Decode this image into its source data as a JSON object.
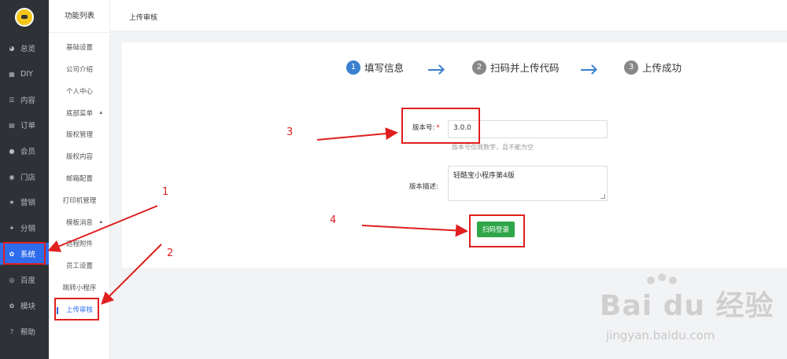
{
  "sidebar": {
    "items": [
      {
        "label": "总览",
        "icon": "chart-pie-icon",
        "glyph": "◕"
      },
      {
        "label": "DIY",
        "icon": "layout-icon",
        "glyph": "▦"
      },
      {
        "label": "内容",
        "icon": "list-icon",
        "glyph": "☰"
      },
      {
        "label": "订单",
        "icon": "order-icon",
        "glyph": "▤"
      },
      {
        "label": "会员",
        "icon": "user-icon",
        "glyph": "●"
      },
      {
        "label": "门店",
        "icon": "location-icon",
        "glyph": "◉"
      },
      {
        "label": "营销",
        "icon": "star-icon",
        "glyph": "★"
      },
      {
        "label": "分销",
        "icon": "users-icon",
        "glyph": "✦"
      },
      {
        "label": "系统",
        "icon": "gear-icon",
        "glyph": "✿"
      },
      {
        "label": "百度",
        "icon": "baidu-icon",
        "glyph": "◎"
      },
      {
        "label": "模块",
        "icon": "module-icon",
        "glyph": "✿"
      },
      {
        "label": "帮助",
        "icon": "help-icon",
        "glyph": "?"
      }
    ],
    "active_index": 8
  },
  "submenu": {
    "title": "功能列表",
    "items": [
      {
        "label": "基础设置"
      },
      {
        "label": "公司介绍"
      },
      {
        "label": "个人中心"
      },
      {
        "label": "底部菜单",
        "caret": "▴"
      },
      {
        "label": "版权管理"
      },
      {
        "label": "版权内容"
      },
      {
        "label": "邮箱配置"
      },
      {
        "label": "打印机管理"
      },
      {
        "label": "模板消息",
        "caret": "▴"
      },
      {
        "label": "远程附件"
      },
      {
        "label": "员工设置"
      },
      {
        "label": "跳转小程序"
      },
      {
        "label": "上传审核"
      }
    ],
    "active_index": 12
  },
  "topbar": {
    "title": "上传审核"
  },
  "steps": [
    {
      "num": "1",
      "label": "填写信息"
    },
    {
      "num": "2",
      "label": "扫码并上传代码"
    },
    {
      "num": "3",
      "label": "上传成功"
    }
  ],
  "form": {
    "version_label": "版本号:",
    "required_mark": "*",
    "version_value": "3.0.0",
    "version_hint": "版本号仅限数字，且不能为空",
    "desc_label": "版本描述:",
    "desc_value": "轻酷宝小程序第4版",
    "submit_label": "扫码登录"
  },
  "annotations": [
    "1",
    "2",
    "3",
    "4"
  ],
  "watermark": {
    "logo": "Bai du 经验",
    "url": "jingyan.baidu.com"
  },
  "colors": {
    "accent": "#2f6cec",
    "step_active": "#3a7fd0",
    "button": "#2fa64a",
    "annotation": "#e01f1f"
  }
}
